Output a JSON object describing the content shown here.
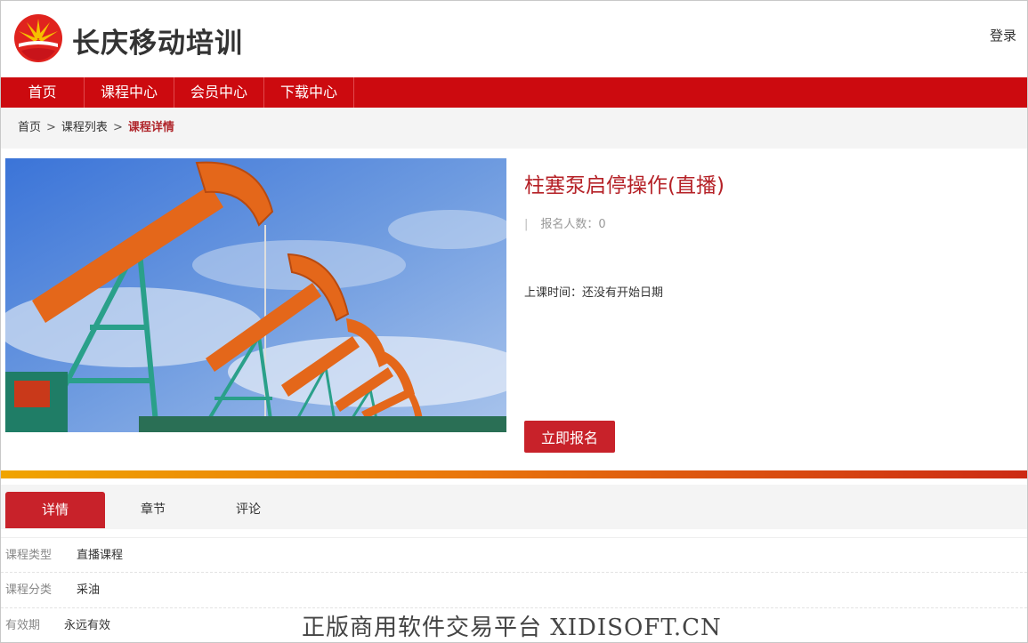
{
  "header": {
    "site_title": "长庆移动培训",
    "login_label": "登录"
  },
  "nav": {
    "items": [
      "首页",
      "课程中心",
      "会员中心",
      "下载中心"
    ]
  },
  "breadcrumb": {
    "home": "首页",
    "sep": ">",
    "list": "课程列表",
    "current": "课程详情"
  },
  "course": {
    "title": "柱塞泵启停操作(直播)",
    "enroll_label": "报名人数：",
    "enroll_count": "0",
    "class_time_label": "上课时间：",
    "class_time_value": "还没有开始日期",
    "enroll_button": "立即报名"
  },
  "tabs": [
    "详情",
    "章节",
    "评论"
  ],
  "details": [
    {
      "key": "课程类型",
      "value": "直播课程"
    },
    {
      "key": "课程分类",
      "value": "采油"
    },
    {
      "key": "有效期",
      "value": "永远有效"
    }
  ],
  "watermark": "正版商用软件交易平台 XIDISOFT.CN",
  "colors": {
    "brand_red": "#cc0a0f",
    "accent_red": "#c8222a",
    "title_red": "#b52127"
  }
}
